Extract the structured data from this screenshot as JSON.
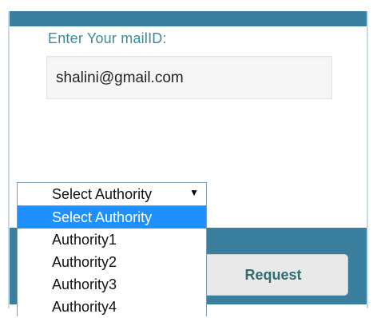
{
  "form": {
    "mail_label": "Enter Your mailID:",
    "mail_value": "shalini@gmail.com"
  },
  "authority_select": {
    "selected": "Select Authority",
    "options": [
      "Select Authority",
      "Authority1",
      "Authority2",
      "Authority3",
      "Authority4"
    ]
  },
  "actions": {
    "request_label": "Request"
  },
  "colors": {
    "header_bar": "#3a7f9d",
    "label_text": "#3d8a9a",
    "highlight": "#1e90ff",
    "button_text": "#2f6e6e"
  },
  "icons": {
    "select_arrow": "chevron-down-icon"
  }
}
